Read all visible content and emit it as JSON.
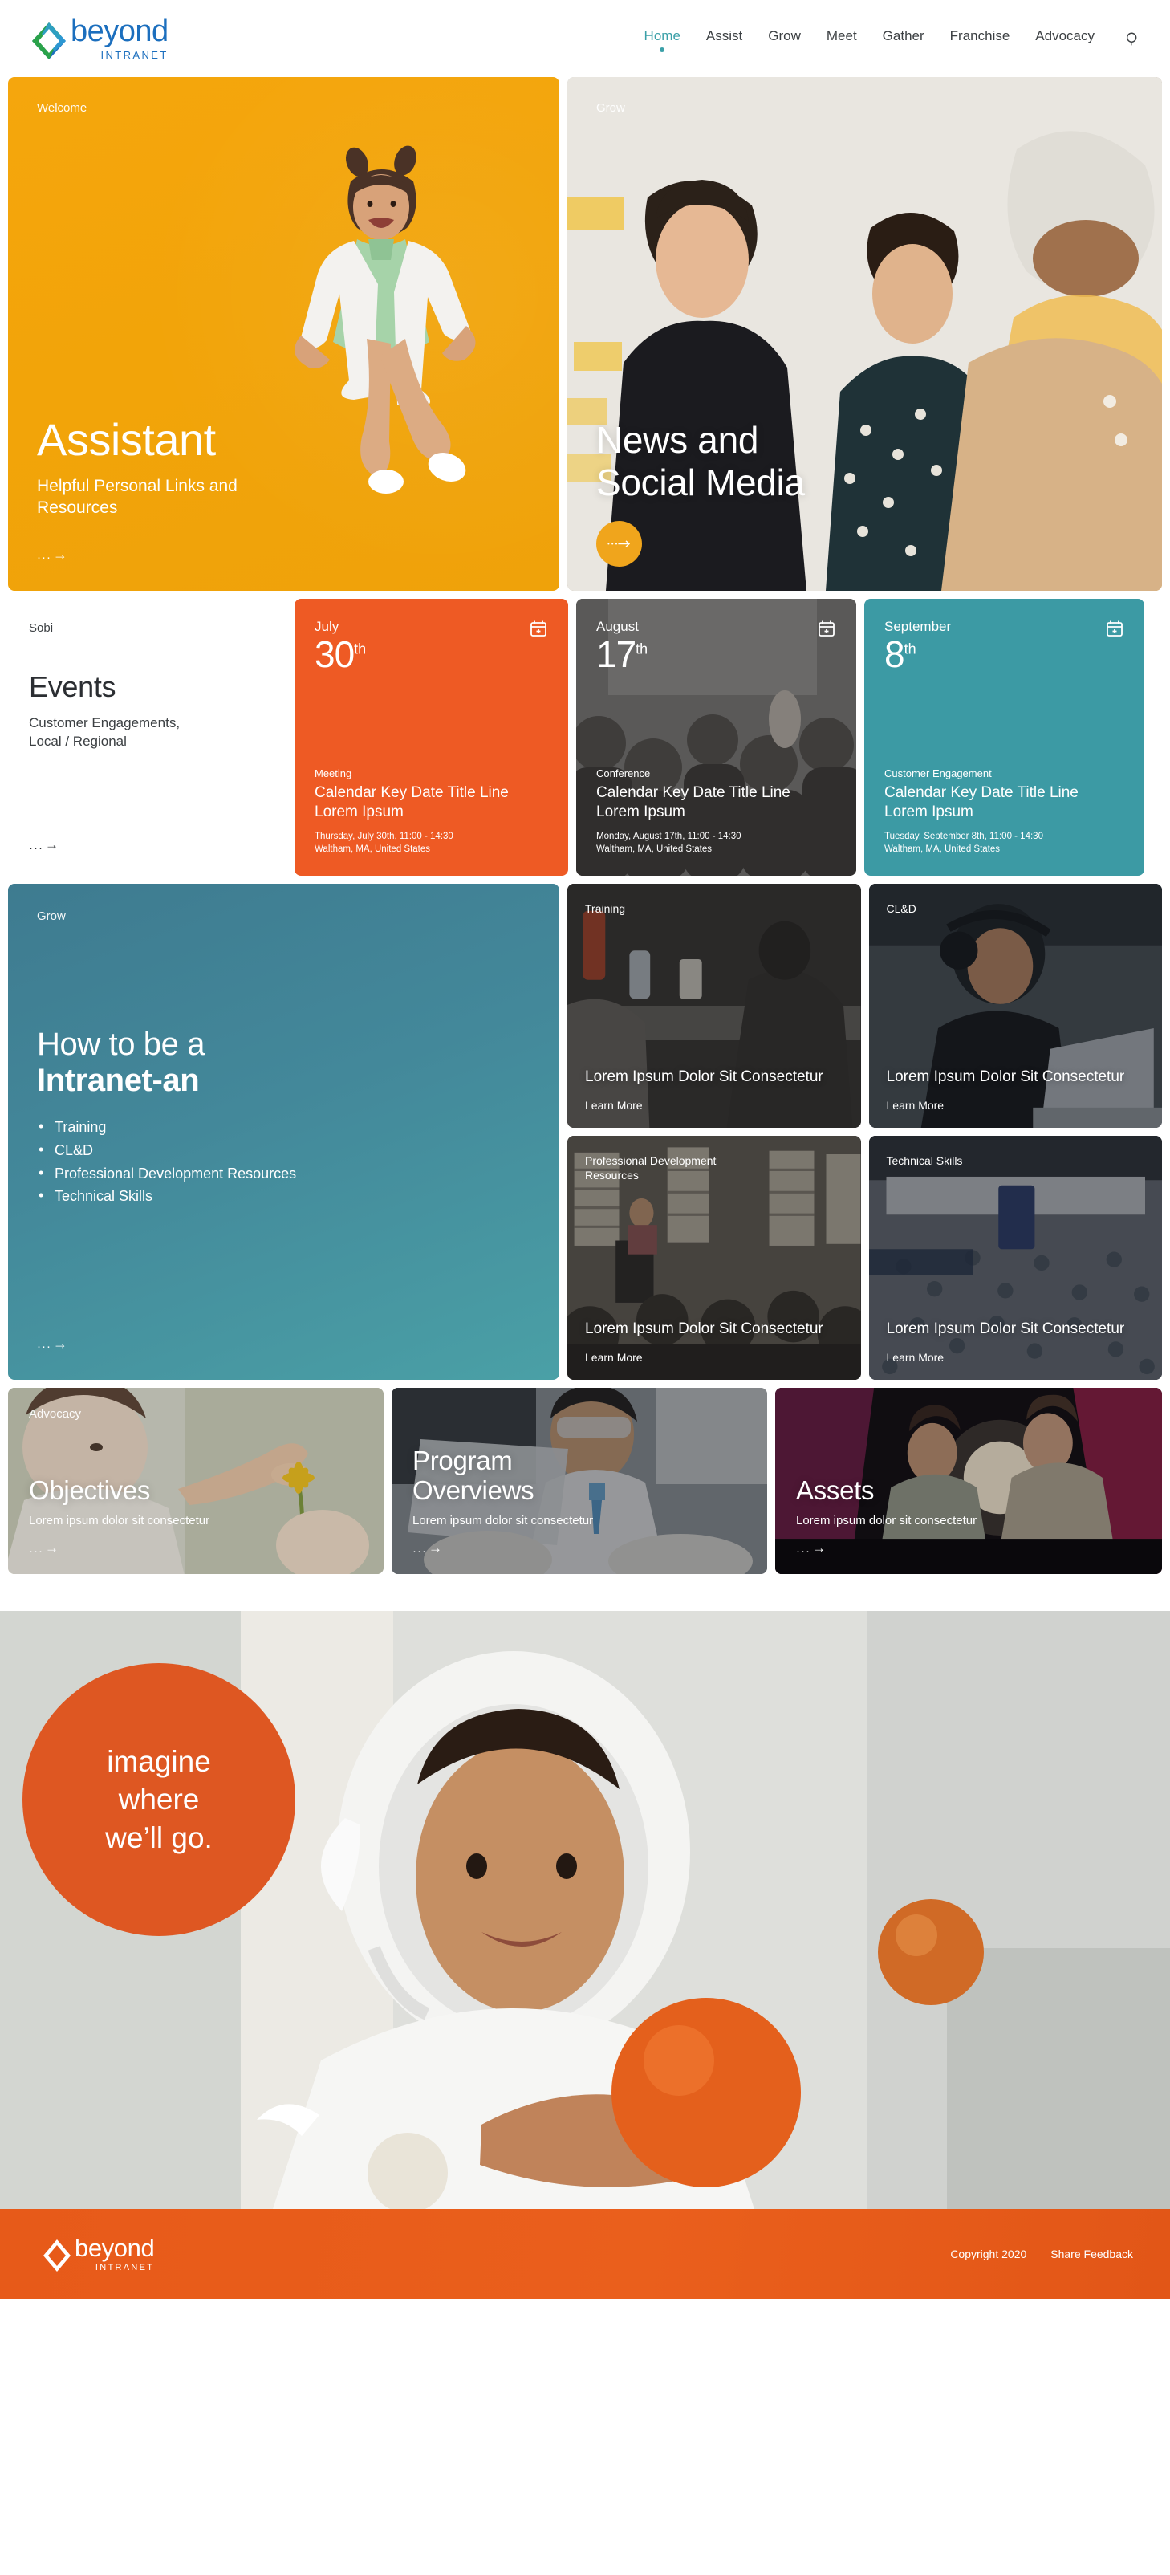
{
  "brand": {
    "word": "beyond",
    "sub": "INTRANET"
  },
  "nav": {
    "items": [
      {
        "label": "Home",
        "active": true
      },
      {
        "label": "Assist",
        "active": false
      },
      {
        "label": "Grow",
        "active": false
      },
      {
        "label": "Meet",
        "active": false
      },
      {
        "label": "Gather",
        "active": false
      },
      {
        "label": "Franchise",
        "active": false
      },
      {
        "label": "Advocacy",
        "active": false
      }
    ],
    "search_icon": "search-icon"
  },
  "hero": {
    "assistant": {
      "eyebrow": "Welcome",
      "title": "Assistant",
      "subtitle": "Helpful Personal Links and Resources",
      "arrow": "→"
    },
    "news": {
      "eyebrow": "Grow",
      "title_line1": "News and",
      "title_line2": "Social Media",
      "button_icon": "arrow-right-icon"
    }
  },
  "events": {
    "kicker": "Sobi",
    "title": "Events",
    "description": "Customer Engagements, Local / Regional",
    "arrow": "→",
    "cards": [
      {
        "month": "July",
        "day": "30",
        "ordinal": "th",
        "type": "Meeting",
        "title": "Calendar Key Date Title Line Lorem Ipsum",
        "when": "Thursday, July 30th, 11:00 - 14:30",
        "where": "Waltham, MA, United States",
        "color": "#ee5a24",
        "icon": "calendar-add-icon"
      },
      {
        "month": "August",
        "day": "17",
        "ordinal": "th",
        "type": "Conference",
        "title": "Calendar Key Date Title Line Lorem Ipsum",
        "when": "Monday, August 17th, 11:00 - 14:30",
        "where": "Waltham, MA, United States",
        "color": "#4d4a46",
        "icon": "calendar-add-icon"
      },
      {
        "month": "September",
        "day": "8",
        "ordinal": "th",
        "type": "Customer Engagement",
        "title": "Calendar Key Date Title Line Lorem Ipsum",
        "when": "Tuesday, September 8th, 11:00 - 14:30",
        "where": "Waltham, MA, United States",
        "color": "#3c9aa4",
        "icon": "calendar-add-icon"
      }
    ]
  },
  "grow": {
    "eyebrow": "Grow",
    "title_line1": "How to be a",
    "title_line2": "Intranet-an",
    "bullets": [
      "Training",
      "CL&D",
      "Professional Development Resources",
      "Technical Skills"
    ],
    "arrow": "→",
    "tiles": [
      {
        "eyebrow": "Training",
        "title": "Lorem Ipsum Dolor Sit Consectetur",
        "more": "Learn More"
      },
      {
        "eyebrow": "CL&D",
        "title": "Lorem Ipsum Dolor Sit Consectetur",
        "more": "Learn More"
      },
      {
        "eyebrow": "Professional Development Resources",
        "title": "Lorem Ipsum Dolor Sit Consectetur",
        "more": "Learn More"
      },
      {
        "eyebrow": "Technical Skills",
        "title": "Lorem Ipsum Dolor Sit Consectetur",
        "more": "Learn More"
      }
    ]
  },
  "features": [
    {
      "eyebrow": "Advocacy",
      "title": "Objectives",
      "subtitle": "Lorem ipsum dolor sit consectetur",
      "arrow": "→"
    },
    {
      "eyebrow": "",
      "title_line1": "Program",
      "title_line2": "Overviews",
      "subtitle": "Lorem ipsum dolor sit consectetur",
      "arrow": "→"
    },
    {
      "eyebrow": "",
      "title": "Assets",
      "subtitle": "Lorem ipsum dolor sit consectetur",
      "arrow": "→"
    }
  ],
  "imagine": {
    "line1": "imagine",
    "line2": "where",
    "line3": "we’ll go.",
    "bubble_color": "#de5722",
    "dot_color": "#f4601c"
  },
  "footer": {
    "word": "beyond",
    "sub": "INTRANET",
    "copyright": "Copyright 2020",
    "feedback": "Share Feedback",
    "bg_color": "#e75a19"
  }
}
